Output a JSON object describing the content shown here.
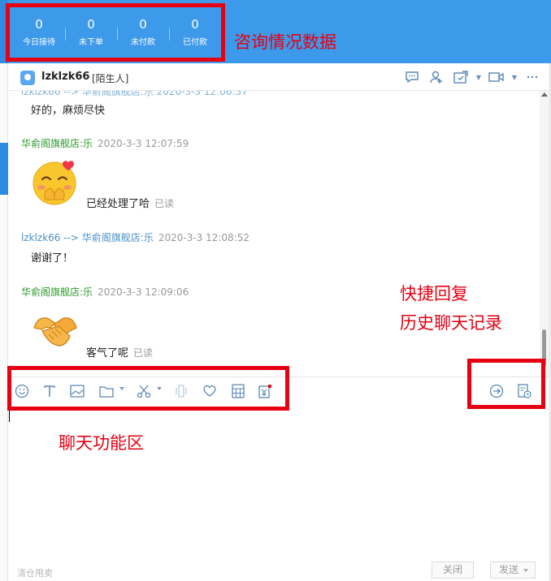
{
  "stats": [
    {
      "value": "0",
      "label": "今日接待"
    },
    {
      "value": "0",
      "label": "未下单"
    },
    {
      "value": "0",
      "label": "未付款"
    },
    {
      "value": "0",
      "label": "已付款"
    }
  ],
  "annotations": {
    "consult_data": "咨询情况数据",
    "quick_reply": "快捷回复",
    "history": "历史聊天记录",
    "chat_functions": "聊天功能区"
  },
  "contact": {
    "name": "lzklzk66",
    "tag": "[陌生人]"
  },
  "header_icons": [
    "chat-bubble-icon",
    "add-person-icon",
    "transfer-icon",
    "video-icon",
    "more-icon"
  ],
  "messages": {
    "m1_text": "好的，麻烦尽快",
    "m2_sender": "华俞阁旗舰店:乐",
    "m2_time": "2020-3-3 12:07:59",
    "m2_text": "已经处理了哈",
    "m2_status": "已读",
    "m3_sender": "lzklzk66 --> 华俞阁旗舰店:乐",
    "m3_time": "2020-3-3 12:08:52",
    "m3_text": "谢谢了！",
    "m4_sender": "华俞阁旗舰店:乐",
    "m4_time": "2020-3-3 12:09:06",
    "m4_text": "客气了呢",
    "m4_status": "已读"
  },
  "toolbar_icons": [
    "emoji-icon",
    "font-icon",
    "image-icon",
    "folder-icon",
    "scissors-icon",
    "vibrate-icon",
    "heart-icon",
    "calculator-icon",
    "coupon-icon",
    "quick-reply-icon",
    "history-icon"
  ],
  "footer": {
    "left_text": "清仓甩卖",
    "close_label": "关闭",
    "send_label": "发送"
  },
  "colors": {
    "topbar": "#3d99ea",
    "annotation_red": "#e60012",
    "seller_green": "#2a9a2a",
    "buyer_blue": "#4a90c8",
    "icon_blue": "#5b87b5"
  }
}
